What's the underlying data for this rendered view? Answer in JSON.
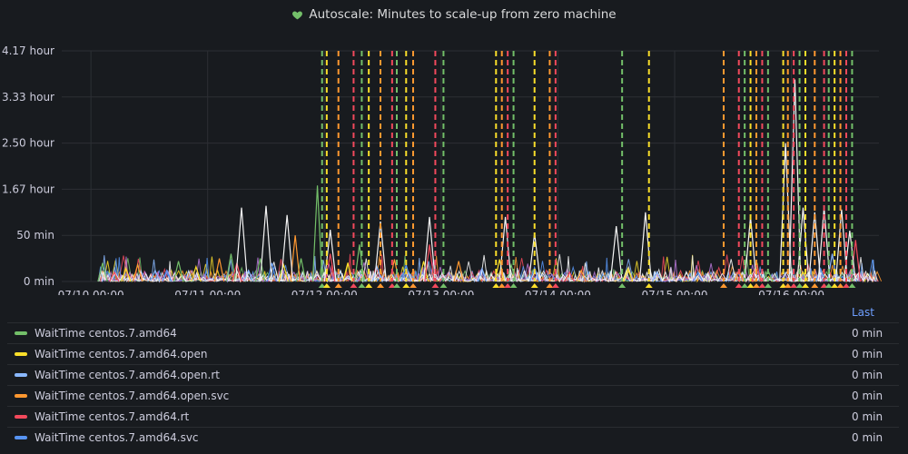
{
  "panel": {
    "title": "Autoscale: Minutes to scale-up from zero machine",
    "status_icon": "heart-icon",
    "status_color": "#73bf69"
  },
  "legend": {
    "column_header": "Last",
    "items": [
      {
        "name": "WaitTime centos.7.amd64",
        "last": "0 min",
        "color": "#73bf69"
      },
      {
        "name": "WaitTime centos.7.amd64.open",
        "last": "0 min",
        "color": "#fade2a"
      },
      {
        "name": "WaitTime centos.7.amd64.open.rt",
        "last": "0 min",
        "color": "#8ab8ff"
      },
      {
        "name": "WaitTime centos.7.amd64.open.svc",
        "last": "0 min",
        "color": "#ff9830"
      },
      {
        "name": "WaitTime centos.7.amd64.rt",
        "last": "0 min",
        "color": "#f2495c"
      },
      {
        "name": "WaitTime centos.7.amd64.svc",
        "last": "0 min",
        "color": "#5794f2"
      }
    ]
  },
  "chart_data": {
    "type": "line",
    "title": "Autoscale: Minutes to scale-up from zero machine",
    "xlabel": "",
    "ylabel": "",
    "x_tick_labels": [
      "07/10 00:00",
      "07/11 00:00",
      "07/12 00:00",
      "07/13 00:00",
      "07/14 00:00",
      "07/15 00:00",
      "07/16 00:00"
    ],
    "x_range_days": [
      -0.25,
      6.75
    ],
    "y_tick_labels": [
      "0 min",
      "50 min",
      "1.67 hour",
      "2.50 hour",
      "3.33 hour",
      "4.17 hour"
    ],
    "y_tick_values_min": [
      0,
      50,
      100,
      150,
      200,
      250
    ],
    "ylim_min": [
      0,
      250
    ],
    "grid": true,
    "legend_placement": "bottom",
    "extra_series_colors": [
      "#b877d9",
      "#ffffff",
      "#f0f0f0"
    ],
    "annotation_colors": [
      "#73bf69",
      "#fade2a",
      "#ff9830",
      "#f2495c"
    ],
    "annotations_days": [
      1.98,
      2.02,
      2.12,
      2.25,
      2.32,
      2.38,
      2.48,
      2.58,
      2.62,
      2.7,
      2.76,
      2.95,
      3.02,
      3.47,
      3.52,
      3.57,
      3.62,
      3.8,
      3.93,
      3.98,
      4.55,
      4.78,
      5.42,
      5.55,
      5.6,
      5.65,
      5.7,
      5.75,
      5.8,
      5.93,
      5.97,
      6.02,
      6.07,
      6.12,
      6.2,
      6.28,
      6.32,
      6.37,
      6.42,
      6.47,
      6.52
    ],
    "series": [
      {
        "name": "WaitTime centos.7.amd64",
        "color": "#73bf69",
        "points": [
          [
            0.1,
            20
          ],
          [
            0.75,
            22
          ],
          [
            1.2,
            30
          ],
          [
            1.45,
            25
          ],
          [
            1.8,
            25
          ],
          [
            1.94,
            104
          ],
          [
            2.3,
            40
          ],
          [
            3.6,
            18
          ],
          [
            5.8,
            12
          ]
        ]
      },
      {
        "name": "WaitTime centos.7.amd64.open",
        "color": "#fade2a",
        "points": [
          [
            0.3,
            14
          ],
          [
            0.9,
            16
          ],
          [
            1.65,
            18
          ],
          [
            2.2,
            20
          ],
          [
            2.85,
            22
          ],
          [
            3.5,
            24
          ],
          [
            4.6,
            14
          ],
          [
            6.1,
            10
          ]
        ]
      },
      {
        "name": "WaitTime centos.7.amd64.open.rt",
        "color": "#8ab8ff",
        "points": [
          [
            0.55,
            12
          ],
          [
            1.35,
            12
          ],
          [
            2.45,
            16
          ],
          [
            3.35,
            14
          ],
          [
            4.85,
            10
          ],
          [
            6.35,
            30
          ]
        ]
      },
      {
        "name": "WaitTime centos.7.amd64.open.svc",
        "color": "#ff9830",
        "points": [
          [
            0.4,
            18
          ],
          [
            1.1,
            25
          ],
          [
            1.75,
            50
          ],
          [
            2.6,
            24
          ],
          [
            3.15,
            22
          ],
          [
            4.2,
            12
          ],
          [
            5.55,
            12
          ]
        ]
      },
      {
        "name": "WaitTime centos.7.amd64.rt",
        "color": "#f2495c",
        "points": [
          [
            0.2,
            10
          ],
          [
            1.25,
            20
          ],
          [
            2.05,
            30
          ],
          [
            2.9,
            40
          ],
          [
            4.1,
            10
          ],
          [
            5.7,
            20
          ],
          [
            6.55,
            45
          ]
        ]
      },
      {
        "name": "WaitTime centos.7.amd64.svc",
        "color": "#5794f2",
        "points": [
          [
            0.65,
            12
          ],
          [
            1.55,
            20
          ],
          [
            2.7,
            18
          ],
          [
            3.8,
            15
          ],
          [
            5.2,
            10
          ],
          [
            6.25,
            14
          ]
        ]
      }
    ]
  }
}
